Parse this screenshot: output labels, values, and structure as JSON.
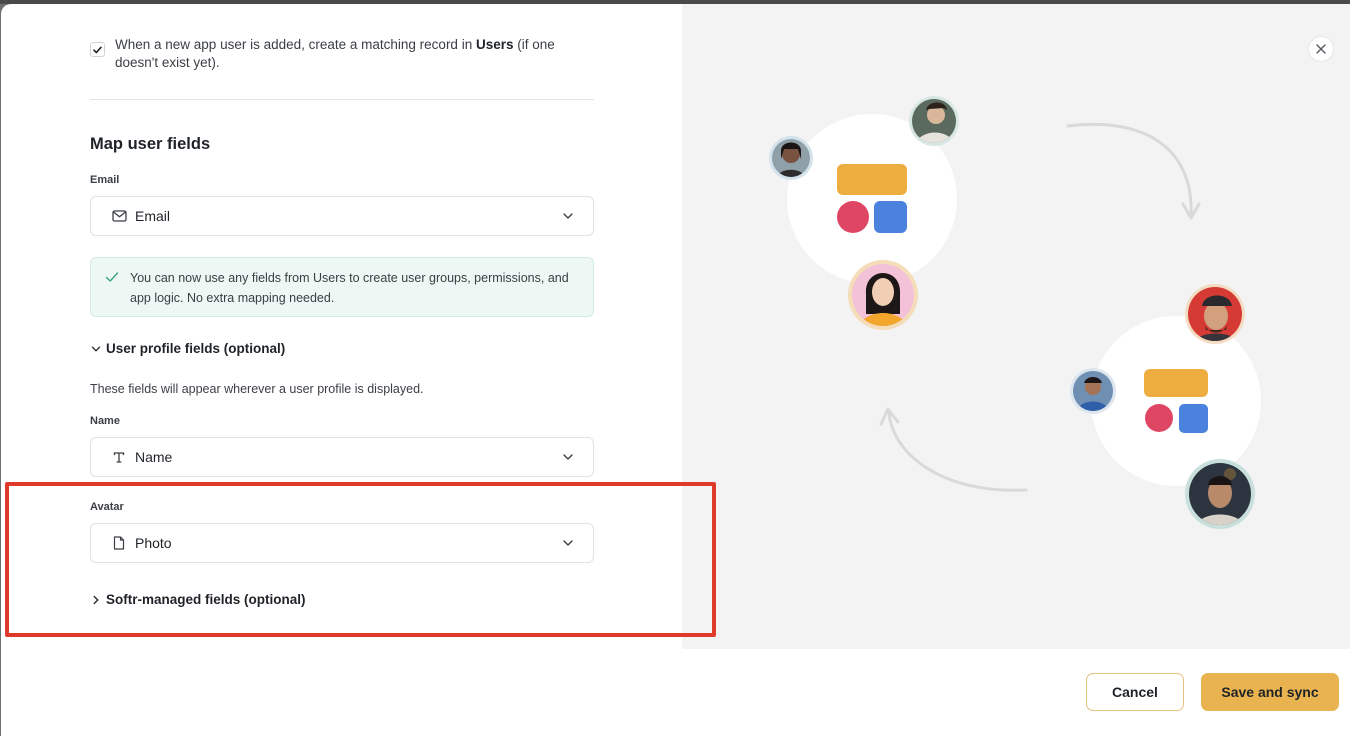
{
  "top_checkbox": {
    "checked": true,
    "text_before": "When a new app user is added, create a matching record in ",
    "text_bold": "Users",
    "text_after": " (if one doesn't exist yet)."
  },
  "map_fields": {
    "title": "Map user fields",
    "email_label": "Email",
    "email_value": "Email",
    "success_before": "You can now use any fields from ",
    "success_bold": "Users",
    "success_after": " to create user groups, permissions, and app logic. No extra mapping needed."
  },
  "profile_section": {
    "title": "User profile fields (optional)",
    "hint": "These fields will appear wherever a user profile is displayed.",
    "name_label": "Name",
    "name_value": "Name",
    "avatar_label": "Avatar",
    "avatar_value": "Photo"
  },
  "managed_section": {
    "title": "Softr-managed fields (optional)"
  },
  "footer": {
    "cancel": "Cancel",
    "save": "Save and sync"
  },
  "icons": {
    "close": "close-icon",
    "mail": "mail-icon",
    "text_type": "text-type-icon",
    "file": "file-icon",
    "chevron": "chevron-down-icon",
    "check": "check-icon"
  },
  "colors": {
    "accent": "#e9b34f",
    "highlight": "#e03a2c",
    "success_bg": "#edf7f3",
    "illus_yellow": "#eeae3f",
    "illus_pink": "#df4664",
    "illus_blue": "#4a82de"
  }
}
